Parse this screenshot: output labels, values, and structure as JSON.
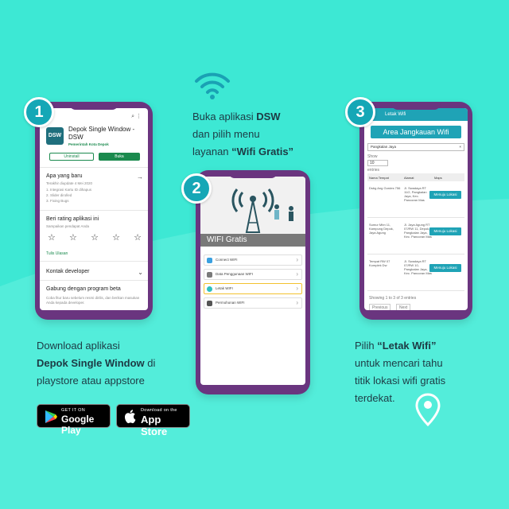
{
  "colors": {
    "background": "#3de8d4",
    "wave_light": "#5cf0dd",
    "teal": "#15a7b6",
    "phone_frame": "#6a357f",
    "play_green": "#1b8a4e"
  },
  "step1": {
    "number": "1",
    "app": {
      "logo_text": "DSW",
      "title": "Depok Single Window - DSW",
      "developer": "Pemerintah Kota Depok",
      "uninstall_label": "Uninstall",
      "open_label": "Buka",
      "whats_new_title": "Apa yang baru",
      "whats_new_sub": "Terakhir diupdate 4 Mei 2020",
      "changes": [
        "1. Integrasi Kartu ID dihapus",
        "2. Slider dirolled",
        "3. Fixing Bugs"
      ],
      "rate_title": "Beri rating aplikasi ini",
      "rate_sub": "Sampaikan pendapat Anda",
      "stars": [
        "☆",
        "☆",
        "☆",
        "☆",
        "☆"
      ],
      "review_link": "Tulis Ulasan",
      "developer_contact": "Kontak developer",
      "beta_title": "Gabung dengan program beta",
      "beta_sub": "Coba fitur baru sebelum resmi dirilis, dan berikan masukan Anda kepada developer."
    },
    "caption_line1": "Download aplikasi",
    "caption_bold": "Depok Single Window",
    "caption_mid": " di",
    "caption_line3": "playstore atau appstore",
    "google_play": {
      "small": "GET IT ON",
      "big": "Google Play"
    },
    "app_store": {
      "small": "Download on the",
      "big": "App Store"
    }
  },
  "step2": {
    "number": "2",
    "caption_pre": "Buka aplikasi ",
    "caption_bold1": "DSW",
    "caption_line2": "dan pilih menu",
    "caption_pre3": "layanan ",
    "caption_bold3": "“Wifi Gratis”",
    "hero_title": "WIFI Gratis",
    "menu": [
      {
        "label": "Connect WIFI",
        "color": "#3aa0e0"
      },
      {
        "label": "Data Penggunaan WIFI",
        "color": "#7a7a7a"
      },
      {
        "label": "Letak WIFI",
        "color": "#2ebfbf",
        "highlight": true
      },
      {
        "label": "Permohonan WIFI",
        "color": "#555555"
      }
    ]
  },
  "step3": {
    "number": "3",
    "bar_title": "Letak Wifi",
    "area_title": "Area Jangkauan Wifi",
    "select_value": "Pangkalan Jaya",
    "show_label": "Show",
    "show_value": "10",
    "entries_label": "entries",
    "headers": [
      "Nama Tempat",
      "Alamat",
      "Maps"
    ],
    "rows": [
      {
        "name": "Dsbg Ang Gordes 756",
        "addr": "Jl. Swadaya RT 11/2, Pangkalan Jaya, Kec. Pancoran Mas",
        "btn": "Menuju Lokasi"
      },
      {
        "name": "Sumur Mbn 11, Kampung Depok, Jaya Agung",
        "addr": "Jl. Jaya Agung RT 07/RW 11, Depok, Pangkalan Jaya, Kec. Pancoran Mas",
        "btn": "Menuju Lokasi"
      },
      {
        "name": "Tempat RW 07 Komplek Dw",
        "addr": "Jl. Swadaya RT 07/RW 10, Pangkalan Jaya, Kec. Pancoran Mas",
        "btn": "Menuju Lokasi"
      }
    ],
    "showing_text": "Showing 1 to 3 of 3 entries",
    "prev": "Previous",
    "next": "Next",
    "caption_pre": "Pilih ",
    "caption_bold": "“Letak Wifi”",
    "caption_line2": "untuk mencari tahu",
    "caption_line3": "titik lokasi wifi gratis",
    "caption_line4": "terdekat."
  },
  "icons": [
    "wifi-icon",
    "location-pin-icon",
    "google-play-icon",
    "apple-icon"
  ]
}
